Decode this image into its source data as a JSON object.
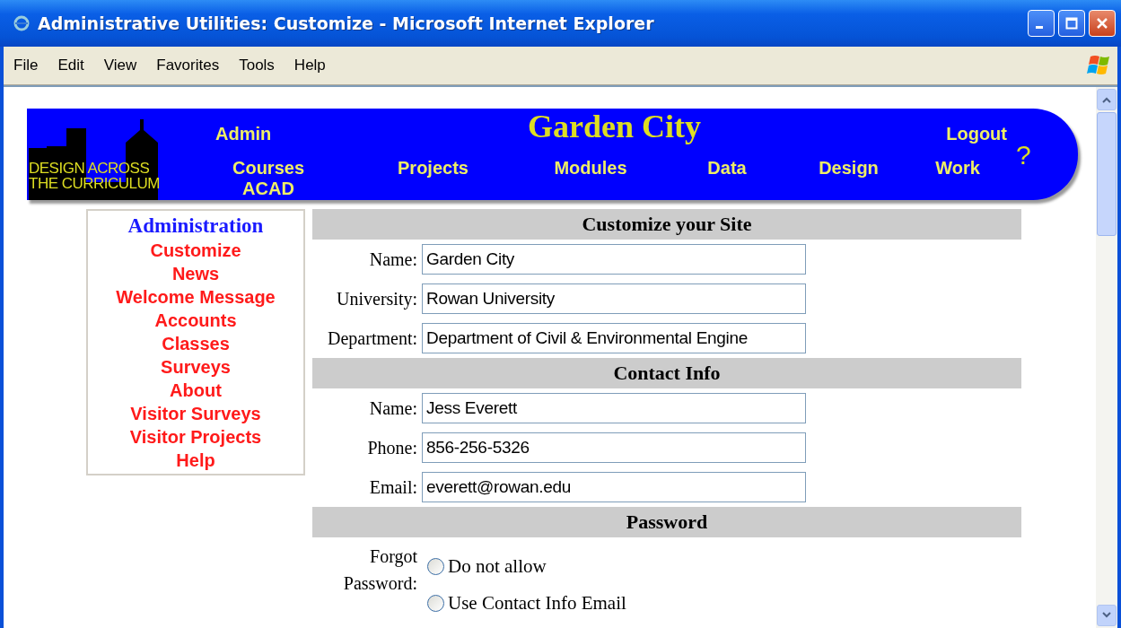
{
  "window": {
    "title": "Administrative Utilities: Customize - Microsoft Internet Explorer"
  },
  "menu": [
    "File",
    "Edit",
    "View",
    "Favorites",
    "Tools",
    "Help"
  ],
  "banner": {
    "logo_lines": [
      "DESIGN ACROSS",
      "THE CURRICULUM"
    ],
    "site_title": "Garden City",
    "admin_link": "Admin",
    "logout_link": "Logout",
    "help_link": "?",
    "nav": [
      {
        "label": "Courses",
        "sub": "ACAD"
      },
      {
        "label": "Projects"
      },
      {
        "label": "Modules"
      },
      {
        "label": "Data"
      },
      {
        "label": "Design"
      },
      {
        "label": "Work"
      }
    ]
  },
  "sidebar": {
    "heading": "Administration",
    "items": [
      "Customize",
      "News",
      "Welcome Message",
      "Accounts",
      "Classes",
      "Surveys",
      "About",
      "Visitor Surveys",
      "Visitor Projects",
      "Help"
    ]
  },
  "form": {
    "sections": [
      {
        "title": "Customize your Site",
        "fields": [
          {
            "kind": "text",
            "label": "Name:",
            "value": "Garden City"
          },
          {
            "kind": "text",
            "label": "University:",
            "value": "Rowan University"
          },
          {
            "kind": "text",
            "label": "Department:",
            "value": "Department of Civil & Environmental Engine"
          }
        ]
      },
      {
        "title": "Contact Info",
        "fields": [
          {
            "kind": "text",
            "label": "Name:",
            "value": "Jess Everett"
          },
          {
            "kind": "text",
            "label": "Phone:",
            "value": "856-256-5326"
          },
          {
            "kind": "text",
            "label": "Email:",
            "value": "everett@rowan.edu"
          }
        ]
      },
      {
        "title": "Password",
        "fields": [
          {
            "kind": "radio",
            "label": "Forgot Password:",
            "options": [
              {
                "label": "Do not allow",
                "selected": false
              },
              {
                "label": "Use Contact Info Email",
                "selected": false
              }
            ]
          }
        ]
      }
    ]
  }
}
